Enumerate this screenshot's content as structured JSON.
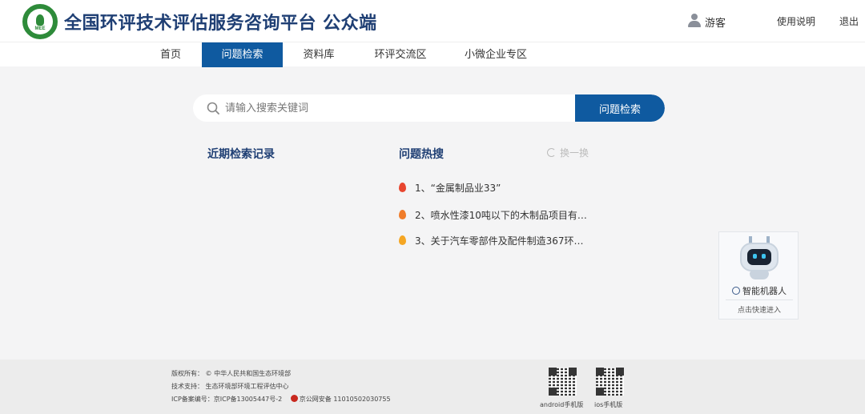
{
  "header": {
    "title": "全国环评技术评估服务咨询平台  公众端",
    "logo_text": "MEE",
    "user_name": "游客",
    "help_label": "使用说明",
    "logout_label": "退出"
  },
  "nav": {
    "items": [
      {
        "label": "首页"
      },
      {
        "label": "问题检索",
        "active": true
      },
      {
        "label": "资料库"
      },
      {
        "label": "环评交流区"
      },
      {
        "label": "小微企业专区"
      }
    ]
  },
  "search": {
    "placeholder": "请输入搜索关键词",
    "value": "",
    "button_label": "问题检索"
  },
  "recent": {
    "title": "近期检索记录"
  },
  "hot": {
    "title": "问题热搜",
    "refresh_label": "换一换",
    "items": [
      {
        "rank": "1、",
        "text": "“金属制品业33”",
        "flame_color": "#e8462f"
      },
      {
        "rank": "2、",
        "text": "喷水性漆10吨以下的木制品项目有…",
        "flame_color": "#f07c2a"
      },
      {
        "rank": "3、",
        "text": "关于汽车零部件及配件制造367环…",
        "flame_color": "#f5a623"
      }
    ]
  },
  "robot": {
    "title": "智能机器人",
    "subtitle": "点击快速进入"
  },
  "footer": {
    "copyright": "版权所有：  © 中华人民共和国生态环境部",
    "support": "技术支持：  生态环境部环境工程评估中心",
    "icp": "ICP备案编号：京ICP备13005447号-2",
    "police": "京公网安备 11010502030755",
    "android_label": "android手机版",
    "ios_label": "ios手机版"
  },
  "colors": {
    "primary": "#0f5aa0",
    "title": "#1f3f74",
    "background": "#f4f4f5"
  }
}
